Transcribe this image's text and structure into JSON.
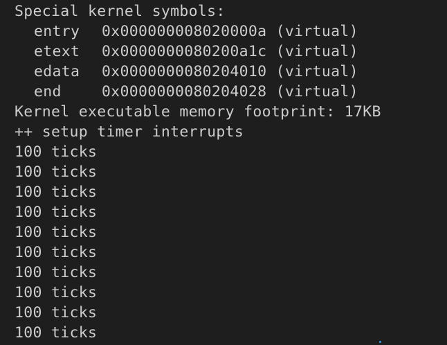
{
  "terminal": {
    "header": "Special kernel symbols:",
    "symbols": [
      {
        "name": "entry",
        "address": "0x000000008020000a",
        "kind": "(virtual)"
      },
      {
        "name": "etext",
        "address": "0x0000000080200a1c",
        "kind": "(virtual)"
      },
      {
        "name": "edata",
        "address": "0x0000000080204010",
        "kind": "(virtual)"
      },
      {
        "name": "end",
        "address": "0x0000000080204028",
        "kind": "(virtual)"
      }
    ],
    "footprint": "Kernel executable memory footprint: 17KB",
    "setup": "++ setup timer interrupts",
    "ticks": [
      "100 ticks",
      "100 ticks",
      "100 ticks",
      "100 ticks",
      "100 ticks",
      "100 ticks",
      "100 ticks",
      "100 ticks",
      "100 ticks",
      "100 ticks"
    ],
    "colors": {
      "background": "#1e1e1e",
      "text": "#cccccc"
    }
  }
}
